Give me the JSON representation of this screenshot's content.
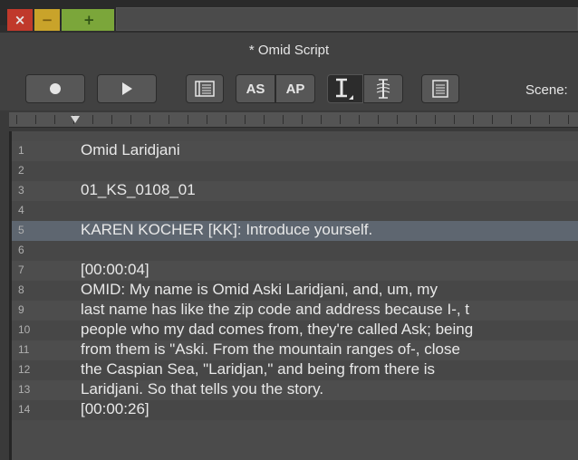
{
  "window": {
    "close_glyph": "×",
    "minimize_glyph": "−",
    "maximize_glyph": "+",
    "title": "* Omid Script"
  },
  "toolbar": {
    "record_icon": "record-icon",
    "play_icon": "play-icon",
    "outline_icon": "list-panel-icon",
    "as_label": "AS",
    "ap_label": "AP",
    "text_cursor_icon": "text-cursor-icon",
    "text_sync_icon": "text-sync-icon",
    "document_icon": "document-icon",
    "scene_label": "Scene:"
  },
  "script": {
    "lines": [
      {
        "n": "1",
        "text": "Omid Laridjani"
      },
      {
        "n": "2",
        "text": ""
      },
      {
        "n": "3",
        "text": "01_KS_0108_01"
      },
      {
        "n": "4",
        "text": ""
      },
      {
        "n": "5",
        "text": "KAREN KOCHER [KK]:  Introduce yourself."
      },
      {
        "n": "6",
        "text": ""
      },
      {
        "n": "7",
        "text": "[00:00:04]"
      },
      {
        "n": "8",
        "text": "OMID:  My name is Omid Aski Laridjani, and, um, my"
      },
      {
        "n": "9",
        "text": "last name has like the zip code and address because I-, t"
      },
      {
        "n": "10",
        "text": "people who my dad comes from, they're called Ask; being"
      },
      {
        "n": "11",
        "text": "from them is \"Aski.  From the mountain ranges of-, close"
      },
      {
        "n": "12",
        "text": "the Caspian Sea, \"Laridjan,\" and being from there is"
      },
      {
        "n": "13",
        "text": "Laridjani.  So that tells you the story."
      },
      {
        "n": "14",
        "text": "[00:00:26]"
      }
    ],
    "highlighted_line": "5"
  }
}
